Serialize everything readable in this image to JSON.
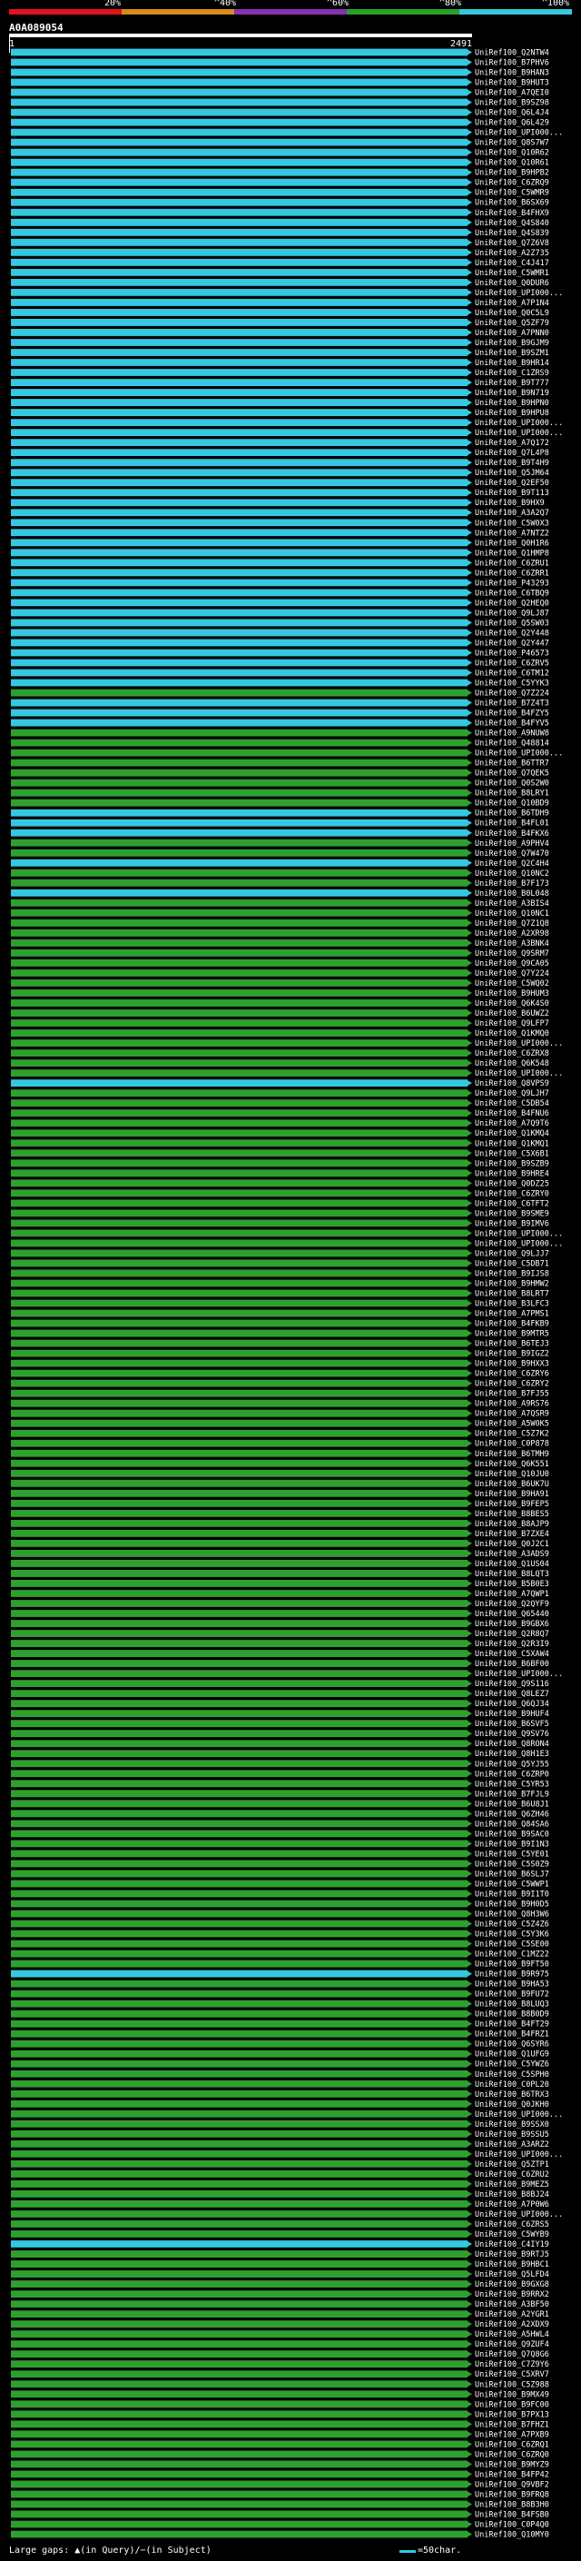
{
  "scale": {
    "ticks": [
      "20%",
      "^40%",
      "^60%",
      "^80%",
      "^100%"
    ],
    "colors": [
      "#e1121b",
      "#d88a1a",
      "#8a2fb0",
      "#2ba02b",
      "#35c8e0"
    ]
  },
  "query": {
    "id": "A0A089054",
    "start": "1",
    "end": "2491"
  },
  "colors": {
    "cyan": "#35c8e0",
    "green": "#2ea02e",
    "gap": "#ffffff"
  },
  "hits": [
    {
      "id": "UniRef100_Q2NTW4",
      "c": "c"
    },
    {
      "id": "UniRef100_B7PHV6",
      "c": "c"
    },
    {
      "id": "UniRef100_B9HAN3",
      "c": "c"
    },
    {
      "id": "UniRef100_B9HUT3",
      "c": "c"
    },
    {
      "id": "UniRef100_A7QEI0",
      "c": "c"
    },
    {
      "id": "UniRef100_B9SZ98",
      "c": "c"
    },
    {
      "id": "UniRef100_Q6L4J4",
      "c": "c"
    },
    {
      "id": "UniRef100_Q6L429",
      "c": "c"
    },
    {
      "id": "UniRef100_UPI000...",
      "c": "c"
    },
    {
      "id": "UniRef100_Q8S7W7",
      "c": "c"
    },
    {
      "id": "UniRef100_Q10R62",
      "c": "c"
    },
    {
      "id": "UniRef100_Q10R61",
      "c": "c"
    },
    {
      "id": "UniRef100_B9HPB2",
      "c": "c"
    },
    {
      "id": "UniRef100_C6ZRQ9",
      "c": "c"
    },
    {
      "id": "UniRef100_C5WMR9",
      "c": "c"
    },
    {
      "id": "UniRef100_B6SX69",
      "c": "c"
    },
    {
      "id": "UniRef100_B4FHX9",
      "c": "c"
    },
    {
      "id": "UniRef100_Q4S840",
      "c": "c"
    },
    {
      "id": "UniRef100_Q4S839",
      "c": "c"
    },
    {
      "id": "UniRef100_Q7Z6V8",
      "c": "c"
    },
    {
      "id": "UniRef100_A2Z735",
      "c": "c"
    },
    {
      "id": "UniRef100_C4J417",
      "c": "c"
    },
    {
      "id": "UniRef100_C5WMR1",
      "c": "c"
    },
    {
      "id": "UniRef100_Q0DUR6",
      "c": "c"
    },
    {
      "id": "UniRef100_UPI000...",
      "c": "c"
    },
    {
      "id": "UniRef100_A7P1N4",
      "c": "c"
    },
    {
      "id": "UniRef100_Q0C5L9",
      "c": "c"
    },
    {
      "id": "UniRef100_Q5ZF79",
      "c": "c"
    },
    {
      "id": "UniRef100_A7PNN0",
      "c": "c"
    },
    {
      "id": "UniRef100_B9GJM9",
      "c": "c"
    },
    {
      "id": "UniRef100_B9SZM1",
      "c": "c"
    },
    {
      "id": "UniRef100_B9HR14",
      "c": "c"
    },
    {
      "id": "UniRef100_C1ZRS9",
      "c": "c"
    },
    {
      "id": "UniRef100_B9T777",
      "c": "c"
    },
    {
      "id": "UniRef100_B9N719",
      "c": "c"
    },
    {
      "id": "UniRef100_B9HPN0",
      "c": "c"
    },
    {
      "id": "UniRef100_B9HPU8",
      "c": "c"
    },
    {
      "id": "UniRef100_UPI000...",
      "c": "c"
    },
    {
      "id": "UniRef100_UPI000...",
      "c": "c"
    },
    {
      "id": "UniRef100_A7Q172",
      "c": "c"
    },
    {
      "id": "UniRef100_Q7L4P8",
      "c": "c"
    },
    {
      "id": "UniRef100_B9T4H9",
      "c": "c"
    },
    {
      "id": "UniRef100_Q5JM64",
      "c": "c"
    },
    {
      "id": "UniRef100_Q2EF50",
      "c": "c"
    },
    {
      "id": "UniRef100_B9T113",
      "c": "c"
    },
    {
      "id": "UniRef100_B9HX9",
      "c": "c"
    },
    {
      "id": "UniRef100_A3A2Q7",
      "c": "c"
    },
    {
      "id": "UniRef100_C5W0X3",
      "c": "c"
    },
    {
      "id": "UniRef100_A7NTZ2",
      "c": "c"
    },
    {
      "id": "UniRef100_Q0H1R6",
      "c": "c"
    },
    {
      "id": "UniRef100_Q1HMP8",
      "c": "c"
    },
    {
      "id": "UniRef100_C6ZRU1",
      "c": "c"
    },
    {
      "id": "UniRef100_C6ZRR1",
      "c": "c"
    },
    {
      "id": "UniRef100_P43293",
      "c": "c"
    },
    {
      "id": "UniRef100_C6TBQ9",
      "c": "c"
    },
    {
      "id": "UniRef100_Q2HEQ0",
      "c": "c"
    },
    {
      "id": "UniRef100_Q9LJ87",
      "c": "c"
    },
    {
      "id": "UniRef100_Q5SW03",
      "c": "c"
    },
    {
      "id": "UniRef100_Q2Y448",
      "c": "c"
    },
    {
      "id": "UniRef100_Q2Y447",
      "c": "c"
    },
    {
      "id": "UniRef100_P46573",
      "c": "c"
    },
    {
      "id": "UniRef100_C6ZRV5",
      "c": "c"
    },
    {
      "id": "UniRef100_C6TM12",
      "c": "c"
    },
    {
      "id": "UniRef100_C5YYK3",
      "c": "c"
    },
    {
      "id": "UniRef100_Q7Z224",
      "c": "g"
    },
    {
      "id": "UniRef100_B7Z4T3",
      "c": "c"
    },
    {
      "id": "UniRef100_B4FZY5",
      "c": "c"
    },
    {
      "id": "UniRef100_B4FYV5",
      "c": "c"
    },
    {
      "id": "UniRef100_A9NUW8",
      "c": "g"
    },
    {
      "id": "UniRef100_Q48814",
      "c": "g"
    },
    {
      "id": "UniRef100_UPI000...",
      "c": "g"
    },
    {
      "id": "UniRef100_B6TTR7",
      "c": "g"
    },
    {
      "id": "UniRef100_Q7QEK5",
      "c": "g"
    },
    {
      "id": "UniRef100_Q0S2W0",
      "c": "g"
    },
    {
      "id": "UniRef100_B8LRY1",
      "c": "g"
    },
    {
      "id": "UniRef100_Q10BD9",
      "c": "g"
    },
    {
      "id": "UniRef100_B6TDH9",
      "c": "c"
    },
    {
      "id": "UniRef100_B4FL01",
      "c": "c"
    },
    {
      "id": "UniRef100_B4FKX6",
      "c": "c"
    },
    {
      "id": "UniRef100_A9PHV4",
      "c": "g"
    },
    {
      "id": "UniRef100_Q7W470",
      "c": "g"
    },
    {
      "id": "UniRef100_Q2C4H4",
      "c": "c"
    },
    {
      "id": "UniRef100_Q10NC2",
      "c": "g"
    },
    {
      "id": "UniRef100_B7F173",
      "c": "g"
    },
    {
      "id": "UniRef100_B0L048",
      "c": "c"
    },
    {
      "id": "UniRef100_A3BIS4",
      "c": "g"
    },
    {
      "id": "UniRef100_Q10NC1",
      "c": "g"
    },
    {
      "id": "UniRef100_Q7Z1Q8",
      "c": "g"
    },
    {
      "id": "UniRef100_A2XR98",
      "c": "g"
    },
    {
      "id": "UniRef100_A3BNK4",
      "c": "g"
    },
    {
      "id": "UniRef100_Q9SRM7",
      "c": "g"
    },
    {
      "id": "UniRef100_Q9CA05",
      "c": "g"
    },
    {
      "id": "UniRef100_Q7Y224",
      "c": "g"
    },
    {
      "id": "UniRef100_C5WQ02",
      "c": "g"
    },
    {
      "id": "UniRef100_B9HUM3",
      "c": "g"
    },
    {
      "id": "UniRef100_Q6K4S0",
      "c": "g"
    },
    {
      "id": "UniRef100_B6UWZ2",
      "c": "g"
    },
    {
      "id": "UniRef100_Q9LFP7",
      "c": "g"
    },
    {
      "id": "UniRef100_Q1KMQ0",
      "c": "g"
    },
    {
      "id": "UniRef100_UPI000...",
      "c": "g"
    },
    {
      "id": "UniRef100_C6ZRX8",
      "c": "g"
    },
    {
      "id": "UniRef100_Q6K548",
      "c": "g"
    },
    {
      "id": "UniRef100_UPI000...",
      "c": "g"
    },
    {
      "id": "UniRef100_Q8VPS9",
      "c": "c"
    },
    {
      "id": "UniRef100_Q9LJH7",
      "c": "g"
    },
    {
      "id": "UniRef100_C5DB54",
      "c": "g"
    },
    {
      "id": "UniRef100_B4FNU6",
      "c": "g"
    },
    {
      "id": "UniRef100_A7Q9T6",
      "c": "g"
    },
    {
      "id": "UniRef100_Q1KMQ4",
      "c": "g"
    },
    {
      "id": "UniRef100_Q1KMQ1",
      "c": "g"
    },
    {
      "id": "UniRef100_C5X6B1",
      "c": "g"
    },
    {
      "id": "UniRef100_B9SZB9",
      "c": "g"
    },
    {
      "id": "UniRef100_B9HRE4",
      "c": "g"
    },
    {
      "id": "UniRef100_Q0DZ25",
      "c": "g"
    },
    {
      "id": "UniRef100_C6ZRY0",
      "c": "g"
    },
    {
      "id": "UniRef100_C6TFT2",
      "c": "g"
    },
    {
      "id": "UniRef100_B9SME9",
      "c": "g"
    },
    {
      "id": "UniRef100_B9IMV6",
      "c": "g"
    },
    {
      "id": "UniRef100_UPI000...",
      "c": "g"
    },
    {
      "id": "UniRef100_UPI000...",
      "c": "g"
    },
    {
      "id": "UniRef100_Q9LJJ7",
      "c": "g"
    },
    {
      "id": "UniRef100_C5DB71",
      "c": "g"
    },
    {
      "id": "UniRef100_B9IJS8",
      "c": "g"
    },
    {
      "id": "UniRef100_B9HMW2",
      "c": "g"
    },
    {
      "id": "UniRef100_B8LRT7",
      "c": "g"
    },
    {
      "id": "UniRef100_B3LFC3",
      "c": "g"
    },
    {
      "id": "UniRef100_A7PMS1",
      "c": "g"
    },
    {
      "id": "UniRef100_B4FKB9",
      "c": "g"
    },
    {
      "id": "UniRef100_B9MTR5",
      "c": "g"
    },
    {
      "id": "UniRef100_B6TEJ3",
      "c": "g"
    },
    {
      "id": "UniRef100_B9IGZ2",
      "c": "g"
    },
    {
      "id": "UniRef100_B9HXX3",
      "c": "g"
    },
    {
      "id": "UniRef100_C6ZRY6",
      "c": "g"
    },
    {
      "id": "UniRef100_C6ZRY2",
      "c": "g"
    },
    {
      "id": "UniRef100_B7FJ55",
      "c": "g"
    },
    {
      "id": "UniRef100_A9RS76",
      "c": "g"
    },
    {
      "id": "UniRef100_A7QSR9",
      "c": "g"
    },
    {
      "id": "UniRef100_A5W0K5",
      "c": "g"
    },
    {
      "id": "UniRef100_C5Z7K2",
      "c": "g"
    },
    {
      "id": "UniRef100_C0P878",
      "c": "g"
    },
    {
      "id": "UniRef100_B6TMH9",
      "c": "g"
    },
    {
      "id": "UniRef100_Q6K551",
      "c": "g"
    },
    {
      "id": "UniRef100_Q10JU0",
      "c": "g"
    },
    {
      "id": "UniRef100_B6UK7U",
      "c": "g"
    },
    {
      "id": "UniRef100_B9HA91",
      "c": "g"
    },
    {
      "id": "UniRef100_B9FEP5",
      "c": "g"
    },
    {
      "id": "UniRef100_B8BES5",
      "c": "g"
    },
    {
      "id": "UniRef100_B8AJP9",
      "c": "g"
    },
    {
      "id": "UniRef100_B7ZXE4",
      "c": "g"
    },
    {
      "id": "UniRef100_Q0J2C1",
      "c": "g"
    },
    {
      "id": "UniRef100_A3ADS9",
      "c": "g"
    },
    {
      "id": "UniRef100_Q1US04",
      "c": "g"
    },
    {
      "id": "UniRef100_B8LQT3",
      "c": "g"
    },
    {
      "id": "UniRef100_B5B0E3",
      "c": "g"
    },
    {
      "id": "UniRef100_A7QWP1",
      "c": "g"
    },
    {
      "id": "UniRef100_Q2QYF9",
      "c": "g"
    },
    {
      "id": "UniRef100_Q65440",
      "c": "g"
    },
    {
      "id": "UniRef100_B9GBX6",
      "c": "g"
    },
    {
      "id": "UniRef100_Q2R8Q7",
      "c": "g"
    },
    {
      "id": "UniRef100_Q2R3I9",
      "c": "g"
    },
    {
      "id": "UniRef100_C5XAW4",
      "c": "g"
    },
    {
      "id": "UniRef100_B6BF00",
      "c": "g"
    },
    {
      "id": "UniRef100_UPI000...",
      "c": "g"
    },
    {
      "id": "UniRef100_Q9S116",
      "c": "g"
    },
    {
      "id": "UniRef100_Q8LEZ7",
      "c": "g"
    },
    {
      "id": "UniRef100_Q6QJ34",
      "c": "g"
    },
    {
      "id": "UniRef100_B9HUF4",
      "c": "g"
    },
    {
      "id": "UniRef100_B6SVF5",
      "c": "g"
    },
    {
      "id": "UniRef100_Q9SV76",
      "c": "g"
    },
    {
      "id": "UniRef100_Q8RON4",
      "c": "g"
    },
    {
      "id": "UniRef100_Q8H1E3",
      "c": "g"
    },
    {
      "id": "UniRef100_Q5YJ55",
      "c": "g"
    },
    {
      "id": "UniRef100_C6ZRP0",
      "c": "g"
    },
    {
      "id": "UniRef100_C5YR53",
      "c": "g"
    },
    {
      "id": "UniRef100_B7FJL9",
      "c": "g"
    },
    {
      "id": "UniRef100_B6U8J1",
      "c": "g"
    },
    {
      "id": "UniRef100_Q6ZH46",
      "c": "g"
    },
    {
      "id": "UniRef100_Q84SA6",
      "c": "g"
    },
    {
      "id": "UniRef100_B9SAC0",
      "c": "g"
    },
    {
      "id": "UniRef100_B9I1N3",
      "c": "g"
    },
    {
      "id": "UniRef100_C5YE01",
      "c": "g"
    },
    {
      "id": "UniRef100_C5S0Z9",
      "c": "g"
    },
    {
      "id": "UniRef100_B6SLJ7",
      "c": "g"
    },
    {
      "id": "UniRef100_C5WWP1",
      "c": "g"
    },
    {
      "id": "UniRef100_B9I1T0",
      "c": "g"
    },
    {
      "id": "UniRef100_B9H0D5",
      "c": "g"
    },
    {
      "id": "UniRef100_Q8H3W6",
      "c": "g"
    },
    {
      "id": "UniRef100_C5Z4Z6",
      "c": "g"
    },
    {
      "id": "UniRef100_C5Y3K6",
      "c": "g"
    },
    {
      "id": "UniRef100_C5SE00",
      "c": "g"
    },
    {
      "id": "UniRef100_C1MZ22",
      "c": "g"
    },
    {
      "id": "UniRef100_B9FT50",
      "c": "g"
    },
    {
      "id": "UniRef100_B9R975",
      "c": "c"
    },
    {
      "id": "UniRef100_B9HA53",
      "c": "g"
    },
    {
      "id": "UniRef100_B9FU72",
      "c": "g"
    },
    {
      "id": "UniRef100_B8LUQ3",
      "c": "g"
    },
    {
      "id": "UniRef100_B8B0D9",
      "c": "g"
    },
    {
      "id": "UniRef100_B4FT29",
      "c": "g"
    },
    {
      "id": "UniRef100_B4FRZ1",
      "c": "g"
    },
    {
      "id": "UniRef100_Q6SYR6",
      "c": "g"
    },
    {
      "id": "UniRef100_Q1UFG9",
      "c": "g"
    },
    {
      "id": "UniRef100_C5YWZ6",
      "c": "g"
    },
    {
      "id": "UniRef100_C5SPH0",
      "c": "g"
    },
    {
      "id": "UniRef100_C0PL20",
      "c": "g"
    },
    {
      "id": "UniRef100_B6TRX3",
      "c": "g"
    },
    {
      "id": "UniRef100_Q0JKH0",
      "c": "g"
    },
    {
      "id": "UniRef100_UPI000...",
      "c": "g"
    },
    {
      "id": "UniRef100_B9SSX0",
      "c": "g"
    },
    {
      "id": "UniRef100_B9SSU5",
      "c": "g"
    },
    {
      "id": "UniRef100_A3ARZ2",
      "c": "g"
    },
    {
      "id": "UniRef100_UPI000...",
      "c": "g"
    },
    {
      "id": "UniRef100_Q5ZTP1",
      "c": "g"
    },
    {
      "id": "UniRef100_C6ZRU2",
      "c": "g"
    },
    {
      "id": "UniRef100_B9MEZ5",
      "c": "g"
    },
    {
      "id": "UniRef100_B8BJ24",
      "c": "g"
    },
    {
      "id": "UniRef100_A7P0W6",
      "c": "g"
    },
    {
      "id": "UniRef100_UPI000...",
      "c": "g"
    },
    {
      "id": "UniRef100_C6ZRS5",
      "c": "g"
    },
    {
      "id": "UniRef100_C5WYB9",
      "c": "g"
    },
    {
      "id": "UniRef100_C4IY19",
      "c": "c"
    },
    {
      "id": "UniRef100_B9RTJ5",
      "c": "g"
    },
    {
      "id": "UniRef100_B9HBC1",
      "c": "g"
    },
    {
      "id": "UniRef100_Q5LFD4",
      "c": "g"
    },
    {
      "id": "UniRef100_B9GXG8",
      "c": "g"
    },
    {
      "id": "UniRef100_B9RRX2",
      "c": "g"
    },
    {
      "id": "UniRef100_A3BF50",
      "c": "g"
    },
    {
      "id": "UniRef100_A2YGR1",
      "c": "g"
    },
    {
      "id": "UniRef100_A2XDX9",
      "c": "g"
    },
    {
      "id": "UniRef100_A5HWL4",
      "c": "g"
    },
    {
      "id": "UniRef100_Q9ZUF4",
      "c": "g"
    },
    {
      "id": "UniRef100_Q7Q8G6",
      "c": "g"
    },
    {
      "id": "UniRef100_C7Z9Y6",
      "c": "g"
    },
    {
      "id": "UniRef100_C5XRV7",
      "c": "g"
    },
    {
      "id": "UniRef100_C5Z988",
      "c": "g"
    },
    {
      "id": "UniRef100_B9MX49",
      "c": "g"
    },
    {
      "id": "UniRef100_B9FC00",
      "c": "g"
    },
    {
      "id": "UniRef100_B7PX13",
      "c": "g"
    },
    {
      "id": "UniRef100_B7FHZ1",
      "c": "g"
    },
    {
      "id": "UniRef100_A7PXB9",
      "c": "g"
    },
    {
      "id": "UniRef100_C6ZRQ1",
      "c": "g"
    },
    {
      "id": "UniRef100_C6ZRQ0",
      "c": "g"
    },
    {
      "id": "UniRef100_B9MYZ9",
      "c": "g"
    },
    {
      "id": "UniRef100_B4FP42",
      "c": "g"
    },
    {
      "id": "UniRef100_Q9VBF2",
      "c": "g"
    },
    {
      "id": "UniRef100_B9FRQ8",
      "c": "g"
    },
    {
      "id": "UniRef100_B8B3H0",
      "c": "g"
    },
    {
      "id": "UniRef100_B4FSB0",
      "c": "g"
    },
    {
      "id": "UniRef100_C0P4Q0",
      "c": "g"
    },
    {
      "id": "UniRef100_Q10MY0",
      "c": "g"
    }
  ],
  "legend": {
    "large_gaps": "Large gaps: ▲(in Query)/−(in Subject)",
    "scale_note": "=50char."
  }
}
